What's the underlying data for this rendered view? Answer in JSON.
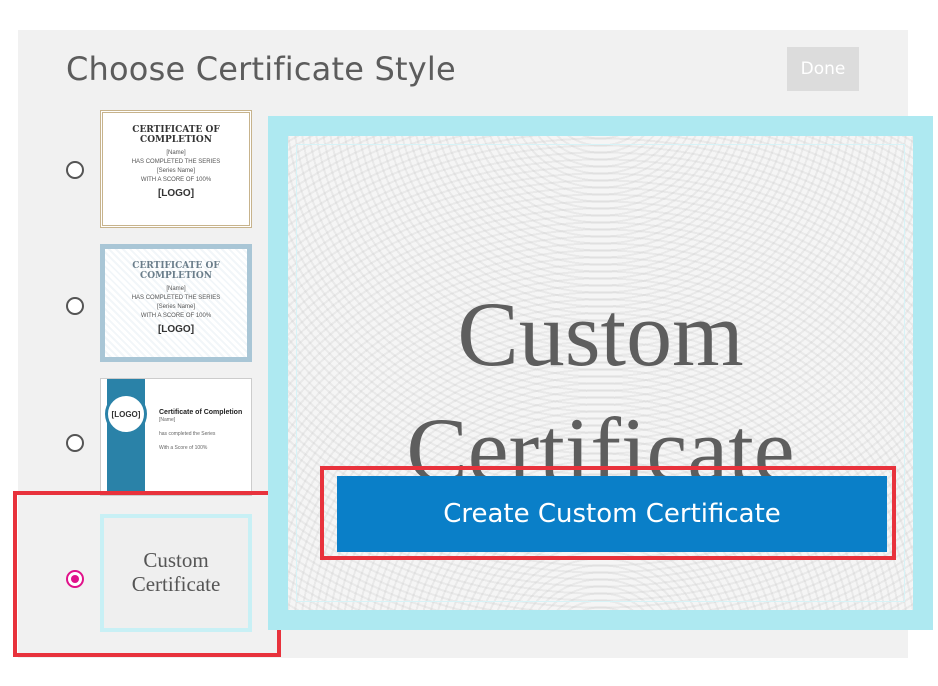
{
  "dialog": {
    "title": "Choose Certificate Style",
    "done_label": "Done"
  },
  "styles": [
    {
      "selected": false,
      "heading": "CERTIFICATE OF COMPLETION",
      "name": "[Name]",
      "line1": "HAS COMPLETED THE SERIES",
      "series": "[Series Name]",
      "score": "WITH A SCORE OF 100%",
      "logo": "[LOGO]"
    },
    {
      "selected": false,
      "heading": "CERTIFICATE OF COMPLETION",
      "name": "[Name]",
      "line1": "HAS COMPLETED THE SERIES",
      "series": "[Series Name]",
      "score": "WITH A SCORE OF 100%",
      "logo": "[LOGO]"
    },
    {
      "selected": false,
      "logo": "[LOGO]",
      "heading": "Certificate of Completion",
      "name": "[Name]",
      "line1": "has completed the Series",
      "score": "With a Score of 100%"
    },
    {
      "selected": true,
      "line1": "Custom",
      "line2": "Certificate"
    }
  ],
  "preview": {
    "line1": "Custom",
    "line2": "Certificate",
    "button_label": "Create Custom Certificate"
  },
  "colors": {
    "accent_button": "#0a7fc8",
    "radio_selected": "#e0128a",
    "highlight": "#e8323c",
    "preview_border": "#aee9f1"
  }
}
